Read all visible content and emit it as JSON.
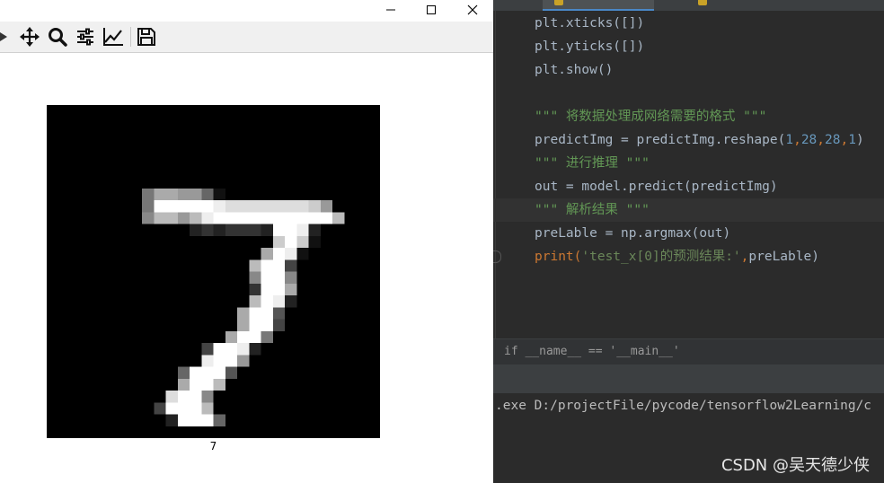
{
  "figure_window": {
    "controls": {
      "minimize": "minimize",
      "maximize": "maximize",
      "close": "close"
    },
    "toolbar": {
      "buttons": [
        "forward-icon",
        "pan-icon",
        "zoom-icon",
        "configure-subplots-icon",
        "edit-axes-icon",
        "save-icon"
      ]
    },
    "image": {
      "colormap": "gray",
      "rows": [
        [
          "0000000000000000000000000000"
        ],
        [
          "0000000000000000000000000000"
        ],
        [
          "0000000000000000000000000000"
        ],
        [
          "0000000000000000000000000000"
        ],
        [
          "0000000000000000000000000000"
        ],
        [
          "0000000000000000000000000000"
        ],
        [
          "0000000000000000000000000000"
        ],
        [
          "000000007AA996100000000000000"
        ],
        [
          "000000007FFFFFEDDDDDDDC9000000"
        ],
        [
          "000000008BB9BEFFFFFFFFFFB00000"
        ],
        [
          "0000000000002323332FFE200000"
        ],
        [
          "0000000000000000000CFC100000"
        ],
        [
          "000000000000000000AFE100000"
        ],
        [
          "00000000000000000BFF4000000"
        ],
        [
          "000000000000000008FF800000000"
        ],
        [
          "000000000000000003FFA0000000"
        ],
        [
          "00000000000000000BFE2000000"
        ],
        [
          "0000000000000000AFF50000000"
        ],
        [
          "0000000000000000AFF40000000"
        ],
        [
          "000000000000000AFF700000000"
        ],
        [
          "00000000000004FFE200000000"
        ],
        [
          "0000000000000EFF90000000000"
        ],
        [
          "000000000006FFF5000000000"
        ],
        [
          "00000000000AFFB00000000000"
        ],
        [
          "0000000000DFF800000000000"
        ],
        [
          "0000000004FFFB000000000000"
        ],
        [
          "00000000002FFF6000000000000"
        ],
        [
          "0000000000000000000000000000"
        ]
      ],
      "xlabel": "7"
    }
  },
  "editor": {
    "code_lines": [
      [
        {
          "t": "plt.xticks([])",
          "c": "fn"
        }
      ],
      [
        {
          "t": "plt.yticks([])",
          "c": "fn"
        }
      ],
      [
        {
          "t": "plt.show()",
          "c": "fn"
        }
      ],
      [
        {
          "t": "",
          "c": "fn"
        }
      ],
      [
        {
          "t": "\"\"\" 将数据处理成网络需要的格式 \"\"\"",
          "c": "doc"
        }
      ],
      [
        {
          "t": "predictImg = predictImg.reshape(",
          "c": "fn"
        },
        {
          "t": "1",
          "c": "num"
        },
        {
          "t": ",",
          "c": "kw"
        },
        {
          "t": "28",
          "c": "num"
        },
        {
          "t": ",",
          "c": "kw"
        },
        {
          "t": "28",
          "c": "num"
        },
        {
          "t": ",",
          "c": "kw"
        },
        {
          "t": "1",
          "c": "num"
        },
        {
          "t": ")",
          "c": "fn"
        }
      ],
      [
        {
          "t": "\"\"\" 进行推理 \"\"\"",
          "c": "doc"
        }
      ],
      [
        {
          "t": "out = model.predict(predictImg)",
          "c": "fn"
        }
      ],
      [
        {
          "t": "\"\"\" 解析结果 \"\"\"",
          "c": "doc"
        }
      ],
      [
        {
          "t": "preLable = np.argmax(out)",
          "c": "fn"
        }
      ],
      [
        {
          "t": "print(",
          "c": "kw"
        },
        {
          "t": "'test_x[0]的预测结果:'",
          "c": "str"
        },
        {
          "t": ",",
          "c": "kw"
        },
        {
          "t": "preLable)",
          "c": "fn"
        }
      ]
    ],
    "breadcrumb": "if __name__ == '__main__'",
    "console_line": ".exe D:/projectFile/pycode/tensorflow2Learning/c",
    "watermark": "CSDN @吴天德少侠"
  }
}
